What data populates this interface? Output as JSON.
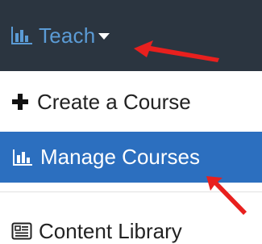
{
  "nav": {
    "teach_label": "Teach",
    "teach_icon": "bar-chart-icon",
    "caret_icon": "caret-down-icon",
    "bar_bg": "#2b3540",
    "accent": "#5b9bd5"
  },
  "menu": {
    "items": [
      {
        "label": "Create a Course",
        "icon": "plus-icon"
      },
      {
        "label": "Manage Courses",
        "icon": "bar-chart-icon",
        "highlighted": true,
        "highlight_color": "#2c6fbf"
      },
      {
        "label": "Content Library",
        "icon": "content-library-icon"
      }
    ]
  },
  "annotations": {
    "arrow_color": "#e8201e",
    "arrows": [
      "points-to-teach-menu",
      "points-to-manage-courses"
    ]
  }
}
